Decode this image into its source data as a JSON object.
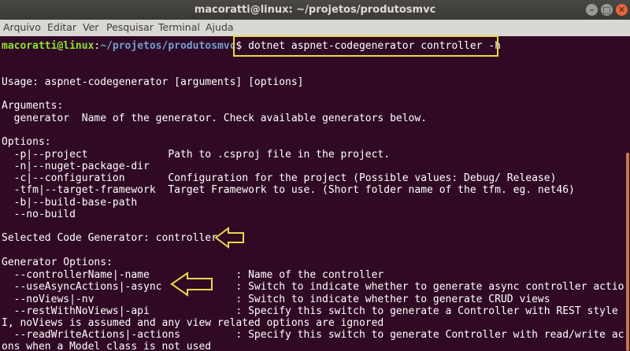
{
  "window": {
    "title": "macoratti@linux: ~/projetos/produtosmvc",
    "buttons": {
      "minimize": "–",
      "maximize": "□",
      "close": "✕"
    }
  },
  "menu": [
    "Arquivo",
    "Editar",
    "Ver",
    "Pesquisar",
    "Terminal",
    "Ajuda"
  ],
  "prompt": {
    "user_host": "macoratti@linux",
    "sep": ":",
    "path": "~/projetos/produtosmvc",
    "symbol": "$",
    "command": " dotnet aspnet-codegenerator controller -h"
  },
  "output_lines": [
    "",
    "",
    "Usage: aspnet-codegenerator [arguments] [options]",
    "",
    "Arguments:",
    "  generator  Name of the generator. Check available generators below.",
    "",
    "Options:",
    "  -p|--project             Path to .csproj file in the project.",
    "  -n|--nuget-package-dir",
    "  -c|--configuration       Configuration for the project (Possible values: Debug/ Release)",
    "  -tfm|--target-framework  Target Framework to use. (Short folder name of the tfm. eg. net46)",
    "  -b|--build-base-path",
    "  --no-build",
    "",
    "Selected Code Generator: controller",
    "",
    "Generator Options:",
    "  --controllerName|-name              : Name of the controller",
    "  --useAsyncActions|-async            : Switch to indicate whether to generate async controller actions",
    "  --noViews|-nv                       : Switch to indicate whether to generate CRUD views",
    "  --restWithNoViews|-api              : Specify this switch to generate a Controller with REST style AP",
    "I, noViews is assumed and any view related options are ignored",
    "  --readWriteActions|-actions         : Specify this switch to generate Controller with read/write acti",
    "ons when a Model class is not used"
  ],
  "colors": {
    "terminal_bg": "#300a24",
    "user_host": "#8ae234",
    "path": "#729fcf",
    "annotation": "#e8d84a",
    "scroll_thumb": "#c8764c"
  }
}
